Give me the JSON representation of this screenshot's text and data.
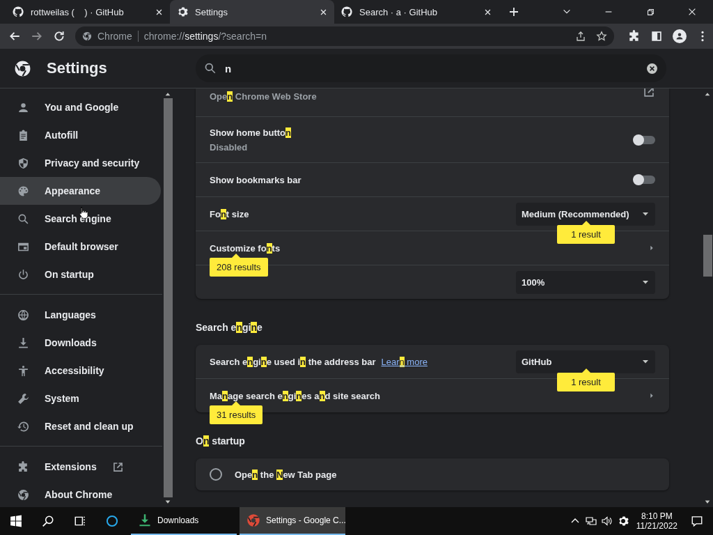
{
  "tabs": [
    {
      "title": "rottweilas (    ) · GitHub",
      "selected": false
    },
    {
      "title": "Settings",
      "selected": true
    },
    {
      "title": "Search · a · GitHub",
      "selected": false
    }
  ],
  "toolbar": {
    "chip": "Chrome",
    "url": [
      {
        "text": "chrome://",
        "strong": false
      },
      {
        "text": "settings",
        "strong": true
      },
      {
        "text": "/?search=n",
        "strong": false
      }
    ]
  },
  "header": {
    "title": "Settings",
    "search_value": "n"
  },
  "sidebar": {
    "groups": [
      [
        {
          "label": "You and Google",
          "selected": false
        },
        {
          "label": "Autofill",
          "selected": false
        },
        {
          "label": "Privacy and security",
          "selected": false
        },
        {
          "label": "Appearance",
          "selected": true
        },
        {
          "label": "Search engine",
          "selected": false
        },
        {
          "label": "Default browser",
          "selected": false
        },
        {
          "label": "On startup",
          "selected": false
        }
      ],
      [
        {
          "label": "Languages",
          "selected": false
        },
        {
          "label": "Downloads",
          "selected": false
        },
        {
          "label": "Accessibility",
          "selected": false
        },
        {
          "label": "System",
          "selected": false
        },
        {
          "label": "Reset and clean up",
          "selected": false
        }
      ],
      [
        {
          "label": "Extensions",
          "selected": false,
          "external": true
        },
        {
          "label": "About Chrome",
          "selected": false,
          "external": false
        }
      ]
    ]
  },
  "sections": [
    {
      "rows": [
        {
          "kind": "link",
          "subtitle": [
            {
              "text": "Ope",
              "match": false
            },
            {
              "text": "n",
              "match": true
            },
            {
              "text": " Chrome Web Store",
              "match": false
            }
          ]
        },
        {
          "kind": "toggle",
          "title": [
            {
              "text": "Show home butto",
              "match": false
            },
            {
              "text": "n",
              "match": true
            }
          ],
          "subtitle": [
            {
              "text": "Disabled",
              "match": false
            }
          ],
          "on": false
        },
        {
          "kind": "toggle",
          "title": [
            {
              "text": "Show bookmarks bar",
              "match": false
            }
          ],
          "on": false
        },
        {
          "kind": "select",
          "title": [
            {
              "text": "Fo",
              "match": false
            },
            {
              "text": "n",
              "match": true
            },
            {
              "text": "t size",
              "match": false
            }
          ],
          "value": "Medium (Recommended)",
          "bubble": "1 result"
        },
        {
          "kind": "arrow",
          "title": [
            {
              "text": "Customize fo",
              "match": false
            },
            {
              "text": "n",
              "match": true
            },
            {
              "text": "ts",
              "match": false
            }
          ],
          "bubble": "208 results"
        },
        {
          "kind": "select",
          "value": "100%"
        }
      ]
    },
    {
      "heading": [
        {
          "text": "Search e",
          "match": false
        },
        {
          "text": "n",
          "match": true
        },
        {
          "text": "gi",
          "match": false
        },
        {
          "text": "n",
          "match": true
        },
        {
          "text": "e",
          "match": false
        }
      ],
      "rows": [
        {
          "kind": "select",
          "title": [
            {
              "text": "Search e",
              "match": false
            },
            {
              "text": "n",
              "match": true
            },
            {
              "text": "gi",
              "match": false
            },
            {
              "text": "n",
              "match": true
            },
            {
              "text": "e used ",
              "match": false
            },
            {
              "text": "i",
              "match": false
            },
            {
              "text": "n",
              "match": true
            },
            {
              "text": " the address bar",
              "match": false
            }
          ],
          "link": [
            {
              "text": "Lear",
              "match": false
            },
            {
              "text": "n",
              "match": true
            },
            {
              "text": " more",
              "match": false
            }
          ],
          "value": "GitHub",
          "bubble": "1 result"
        },
        {
          "kind": "arrow",
          "title": [
            {
              "text": "Ma",
              "match": false
            },
            {
              "text": "n",
              "match": true
            },
            {
              "text": "age search e",
              "match": false
            },
            {
              "text": "n",
              "match": true
            },
            {
              "text": "gi",
              "match": false
            },
            {
              "text": "n",
              "match": true
            },
            {
              "text": "es a",
              "match": false
            },
            {
              "text": "n",
              "match": true
            },
            {
              "text": "d site search",
              "match": false
            }
          ],
          "bubble": "31 results"
        }
      ]
    },
    {
      "heading": [
        {
          "text": "O",
          "match": false
        },
        {
          "text": "n",
          "match": true
        },
        {
          "text": " startup",
          "match": false
        }
      ],
      "rows": [
        {
          "kind": "radio",
          "title": [
            {
              "text": "Ope",
              "match": false
            },
            {
              "text": "n",
              "match": true
            },
            {
              "text": " the ",
              "match": false
            },
            {
              "text": "N",
              "match": true
            },
            {
              "text": "ew Tab page",
              "match": false
            }
          ],
          "selected": false
        }
      ]
    }
  ],
  "taskbar": {
    "apps": [
      {
        "label": "Downloads",
        "selected": false,
        "running": true
      },
      {
        "label": "Settings - Google C...",
        "selected": true,
        "running": true
      }
    ],
    "time": "8:10 PM",
    "date": "11/21/2022"
  }
}
